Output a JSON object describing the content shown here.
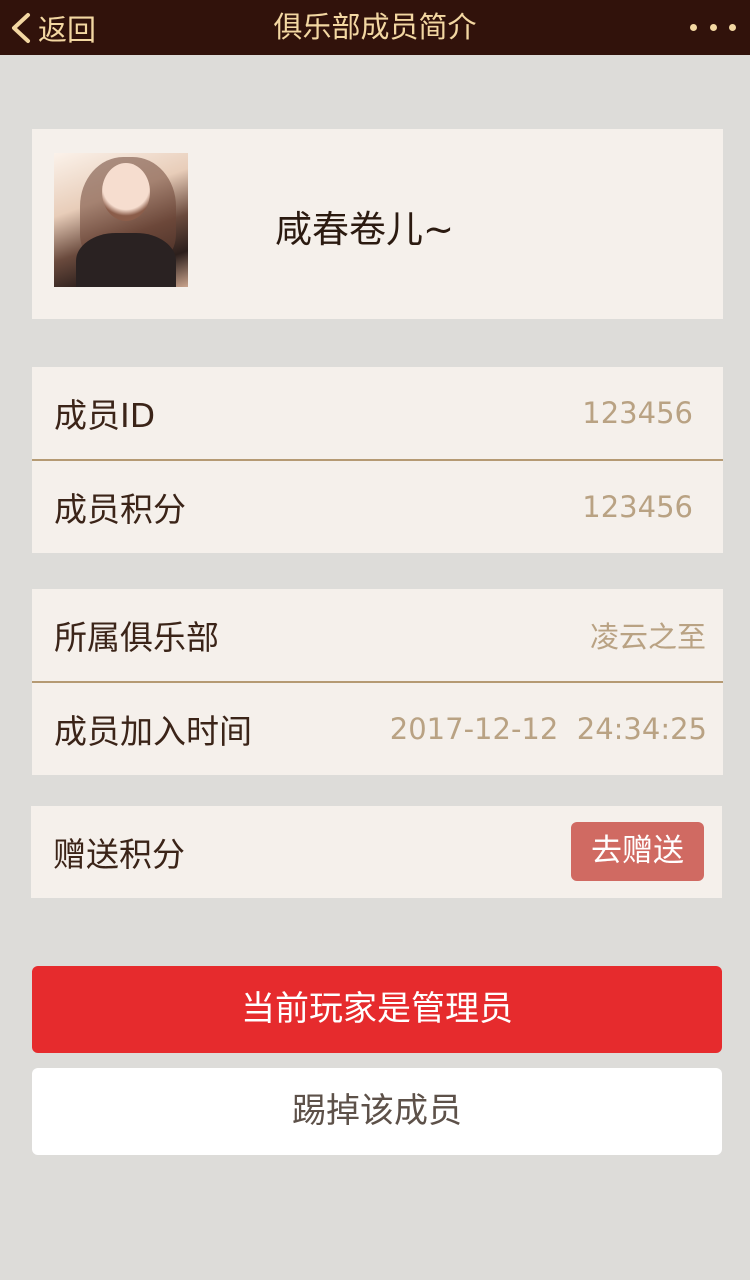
{
  "nav": {
    "back_label": "返回",
    "title": "俱乐部成员简介",
    "back_icon": "chevron-left-icon",
    "more_icon": "more-dots-icon"
  },
  "profile": {
    "nickname": "咸春卷儿~"
  },
  "member": {
    "id_label": "成员ID",
    "id_value": "123456",
    "points_label": "成员积分",
    "points_value": "123456"
  },
  "club": {
    "club_label": "所属俱乐部",
    "club_value": "凌云之至",
    "join_label": "成员加入时间",
    "join_value": "2017-12-12  24:34:25"
  },
  "gift": {
    "label": "赠送积分",
    "button_label": "去赠送"
  },
  "actions": {
    "admin_label": "当前玩家是管理员",
    "kick_label": "踢掉该成员"
  },
  "colors": {
    "nav_bg": "#31120b",
    "nav_text": "#f3d7a2",
    "accent_red": "#e62b2d",
    "gift_button": "#d06a62",
    "value_text": "#b9a283"
  }
}
